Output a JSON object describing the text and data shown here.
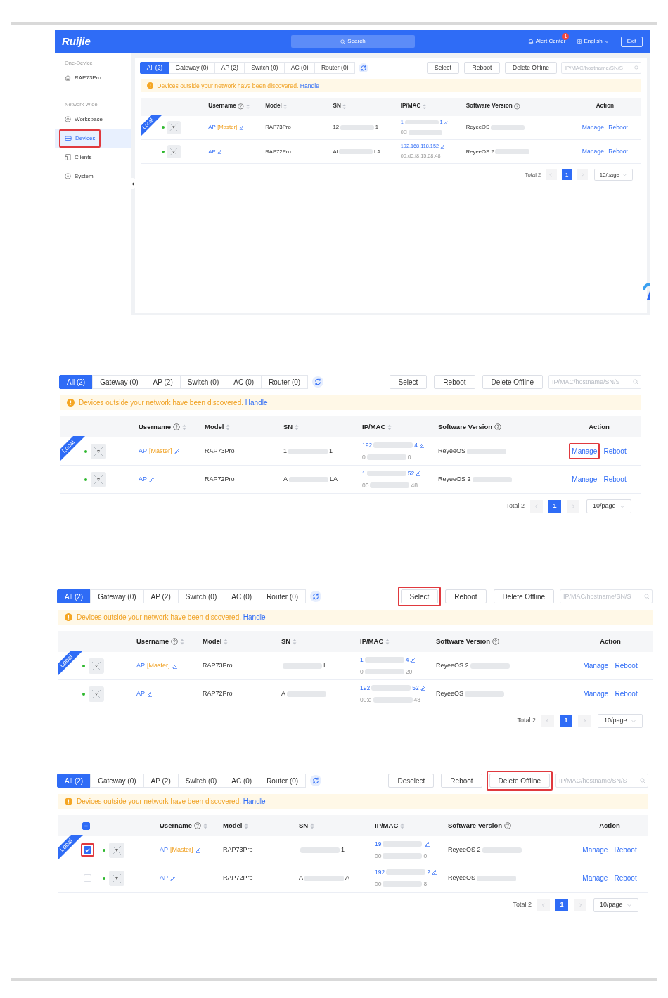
{
  "screenshots": [
    {
      "kind": "app",
      "header": {
        "logo": "Ruijie",
        "search": "Search",
        "alert": "Alert Center",
        "alert_count": "1",
        "language": "English",
        "exit": "Exit"
      },
      "sidebar": [
        {
          "heading": "One-Device",
          "items": [
            {
              "label": "RAP73Pro",
              "selected": false,
              "highlighted": false
            }
          ]
        },
        {
          "heading": "Network Wide",
          "items": [
            {
              "label": "Workspace",
              "selected": false,
              "highlighted": false
            },
            {
              "label": "Devices",
              "selected": true,
              "highlighted": true
            },
            {
              "label": "Clients",
              "selected": false,
              "highlighted": false
            },
            {
              "label": "System",
              "selected": false,
              "highlighted": false
            }
          ]
        }
      ],
      "panel": {
        "tabs": [
          {
            "label": "All (2)",
            "selected": true
          },
          {
            "label": "Gateway (0)",
            "selected": false
          },
          {
            "label": "AP (2)",
            "selected": false
          },
          {
            "label": "Switch (0)",
            "selected": false
          },
          {
            "label": "AC (0)",
            "selected": false
          },
          {
            "label": "Router (0)",
            "selected": false
          }
        ],
        "buttons": [
          {
            "label": "Select",
            "highlighted": false
          },
          {
            "label": "Reboot",
            "highlighted": false
          },
          {
            "label": "Delete Offline",
            "highlighted": false
          }
        ],
        "search": {
          "placeholder": "IP/MAC/hostname/SN/S"
        },
        "notice": {
          "text": "Devices outside your network have been discovered.",
          "link": "Handle"
        },
        "table": {
          "columns": [
            {
              "label": "Username",
              "help": true,
              "sortable": true
            },
            {
              "label": "Model",
              "help": false,
              "sortable": true
            },
            {
              "label": "SN",
              "help": false,
              "sortable": true
            },
            {
              "label": "IP/MAC",
              "help": false,
              "sortable": true
            },
            {
              "label": "Software Version",
              "help": true,
              "sortable": false
            },
            {
              "label": "Action",
              "help": false,
              "sortable": false
            }
          ],
          "rows": [
            {
              "local_label": "Local",
              "online": true,
              "username": "AP",
              "tag": "[Master]",
              "model": "RAP73Pro",
              "sn": {
                "start": "12",
                "blurred": true,
                "end": "1"
              },
              "ip": {
                "start": "1",
                "blurred": true,
                "end": "1"
              },
              "mac": {
                "start": "0C",
                "blurred": true
              },
              "software": {
                "start": "ReyeeOS",
                "blurred": true
              },
              "actions": [
                {
                  "label": "Manage",
                  "highlighted": false
                },
                {
                  "label": "Reboot",
                  "highlighted": false
                }
              ]
            },
            {
              "online": true,
              "username": "AP",
              "model": "RAP72Pro",
              "sn": {
                "start": "Al",
                "blurred": true,
                "end": "LA"
              },
              "ip": {
                "start": "192.168.118.152",
                "blurred": false
              },
              "mac": {
                "start": "00:d0:f8:15:08:48",
                "blurred": false
              },
              "software": {
                "start": "ReyeeOS 2",
                "blurred": true
              },
              "actions": [
                {
                  "label": "Manage",
                  "highlighted": false
                },
                {
                  "label": "Reboot",
                  "highlighted": false
                }
              ]
            }
          ]
        },
        "pagination": {
          "total": "Total 2",
          "page": "1",
          "page_size": "10/page"
        }
      }
    },
    {
      "kind": "panel",
      "panel": {
        "tabs": [
          {
            "label": "All (2)",
            "selected": true
          },
          {
            "label": "Gateway (0)",
            "selected": false
          },
          {
            "label": "AP (2)",
            "selected": false
          },
          {
            "label": "Switch (0)",
            "selected": false
          },
          {
            "label": "AC (0)",
            "selected": false
          },
          {
            "label": "Router (0)",
            "selected": false
          }
        ],
        "buttons": [
          {
            "label": "Select",
            "highlighted": false
          },
          {
            "label": "Reboot",
            "highlighted": false
          },
          {
            "label": "Delete Offline",
            "highlighted": false
          }
        ],
        "search": {
          "placeholder": "IP/MAC/hostname/SN/S"
        },
        "notice": {
          "text": "Devices outside your network have been discovered.",
          "link": "Handle"
        },
        "table": {
          "columns": [
            {
              "label": "Username",
              "help": true,
              "sortable": true
            },
            {
              "label": "Model",
              "help": false,
              "sortable": true
            },
            {
              "label": "SN",
              "help": false,
              "sortable": true
            },
            {
              "label": "IP/MAC",
              "help": false,
              "sortable": true
            },
            {
              "label": "Software Version",
              "help": true,
              "sortable": false
            },
            {
              "label": "Action",
              "help": false,
              "sortable": false
            }
          ],
          "rows": [
            {
              "local_label": "Local",
              "online": true,
              "username": "AP",
              "tag": "[Master]",
              "model": "RAP73Pro",
              "sn": {
                "start": "1",
                "blurred": true,
                "end": "1"
              },
              "ip": {
                "start": "192",
                "blurred": true,
                "end": "4"
              },
              "mac": {
                "start": "0",
                "blurred": true,
                "end": "0"
              },
              "software": {
                "start": "ReyeeOS",
                "blurred": true
              },
              "actions": [
                {
                  "label": "Manage",
                  "highlighted": true
                },
                {
                  "label": "Reboot",
                  "highlighted": false
                }
              ]
            },
            {
              "online": true,
              "username": "AP",
              "model": "RAP72Pro",
              "sn": {
                "start": "A",
                "blurred": true,
                "end": "LA"
              },
              "ip": {
                "start": "1",
                "blurred": true,
                "end": "52"
              },
              "mac": {
                "start": "00",
                "blurred": true,
                "end": "48"
              },
              "software": {
                "start": "ReyeeOS 2",
                "blurred": true
              },
              "actions": [
                {
                  "label": "Manage",
                  "highlighted": false
                },
                {
                  "label": "Reboot",
                  "highlighted": false
                }
              ]
            }
          ]
        },
        "pagination": {
          "total": "Total 2",
          "page": "1",
          "page_size": "10/page"
        }
      }
    },
    {
      "kind": "panel",
      "panel": {
        "tabs": [
          {
            "label": "All (2)",
            "selected": true
          },
          {
            "label": "Gateway (0)",
            "selected": false
          },
          {
            "label": "AP (2)",
            "selected": false
          },
          {
            "label": "Switch (0)",
            "selected": false
          },
          {
            "label": "AC (0)",
            "selected": false
          },
          {
            "label": "Router (0)",
            "selected": false
          }
        ],
        "buttons": [
          {
            "label": "Select",
            "highlighted": true
          },
          {
            "label": "Reboot",
            "highlighted": false
          },
          {
            "label": "Delete Offline",
            "highlighted": false
          }
        ],
        "search": {
          "placeholder": "IP/MAC/hostname/SN/S"
        },
        "notice": {
          "text": "Devices outside your network have been discovered.",
          "link": "Handle"
        },
        "table": {
          "columns": [
            {
              "label": "Username",
              "help": true,
              "sortable": true
            },
            {
              "label": "Model",
              "help": false,
              "sortable": true
            },
            {
              "label": "SN",
              "help": false,
              "sortable": true
            },
            {
              "label": "IP/MAC",
              "help": false,
              "sortable": true
            },
            {
              "label": "Software Version",
              "help": true,
              "sortable": false
            },
            {
              "label": "Action",
              "help": false,
              "sortable": false
            }
          ],
          "rows": [
            {
              "local_label": "Local",
              "online": true,
              "username": "AP",
              "tag": "[Master]",
              "model": "RAP73Pro",
              "sn": {
                "blurred": true,
                "end": "I"
              },
              "ip": {
                "start": "1",
                "blurred": true,
                "end": "4"
              },
              "mac": {
                "start": "0",
                "blurred": true,
                "end": "20"
              },
              "software": {
                "start": "ReyeeOS 2",
                "blurred": true
              },
              "actions": [
                {
                  "label": "Manage",
                  "highlighted": false
                },
                {
                  "label": "Reboot",
                  "highlighted": false
                }
              ]
            },
            {
              "online": true,
              "username": "AP",
              "model": "RAP72Pro",
              "sn": {
                "start": "A",
                "blurred": true
              },
              "ip": {
                "start": "192",
                "blurred": true,
                "end": "52"
              },
              "mac": {
                "start": "00:d",
                "blurred": true,
                "end": "48"
              },
              "software": {
                "start": "ReyeeOS",
                "blurred": true
              },
              "actions": [
                {
                  "label": "Manage",
                  "highlighted": false
                },
                {
                  "label": "Reboot",
                  "highlighted": false
                }
              ]
            }
          ]
        },
        "pagination": {
          "total": "Total 2",
          "page": "1",
          "page_size": "10/page"
        }
      }
    },
    {
      "kind": "panel",
      "panel": {
        "tabs": [
          {
            "label": "All (2)",
            "selected": true
          },
          {
            "label": "Gateway (0)",
            "selected": false
          },
          {
            "label": "AP (2)",
            "selected": false
          },
          {
            "label": "Switch (0)",
            "selected": false
          },
          {
            "label": "AC (0)",
            "selected": false
          },
          {
            "label": "Router (0)",
            "selected": false
          }
        ],
        "buttons": [
          {
            "label": "Deselect",
            "highlighted": false
          },
          {
            "label": "Reboot",
            "highlighted": false
          },
          {
            "label": "Delete Offline",
            "highlighted": true
          }
        ],
        "search": {
          "placeholder": "IP/MAC/hostname/SN/S"
        },
        "notice": {
          "text": "Devices outside your network have been discovered.",
          "link": "Handle"
        },
        "table": {
          "select_all": {
            "checked": true,
            "indeterminate": true
          },
          "columns": [
            {
              "label": "Username",
              "help": true,
              "sortable": true
            },
            {
              "label": "Model",
              "help": false,
              "sortable": true
            },
            {
              "label": "SN",
              "help": false,
              "sortable": true
            },
            {
              "label": "IP/MAC",
              "help": false,
              "sortable": true
            },
            {
              "label": "Software Version",
              "help": true,
              "sortable": false
            },
            {
              "label": "Action",
              "help": false,
              "sortable": false
            }
          ],
          "rows": [
            {
              "local_label": "Local",
              "checkbox": {
                "checked": true,
                "highlighted": true
              },
              "online": true,
              "username": "AP",
              "tag": "[Master]",
              "model": "RAP73Pro",
              "sn": {
                "blurred": true,
                "end": "1"
              },
              "ip": {
                "start": "19",
                "blurred": true
              },
              "mac": {
                "start": "00",
                "blurred": true,
                "end": "0"
              },
              "software": {
                "start": "ReyeeOS 2",
                "blurred": true
              },
              "actions": [
                {
                  "label": "Manage",
                  "highlighted": false
                },
                {
                  "label": "Reboot",
                  "highlighted": false
                }
              ]
            },
            {
              "checkbox": {
                "checked": false,
                "highlighted": false
              },
              "online": true,
              "username": "AP",
              "model": "RAP72Pro",
              "sn": {
                "start": "A",
                "blurred": true,
                "end": "A"
              },
              "ip": {
                "start": "192",
                "blurred": true,
                "end": "2"
              },
              "mac": {
                "start": "00",
                "blurred": true,
                "end": "8"
              },
              "software": {
                "start": "ReyeeOS",
                "blurred": true
              },
              "actions": [
                {
                  "label": "Manage",
                  "highlighted": false
                },
                {
                  "label": "Reboot",
                  "highlighted": false
                }
              ]
            }
          ]
        },
        "pagination": {
          "total": "Total 2",
          "page": "1",
          "page_size": "10/page"
        }
      }
    }
  ]
}
